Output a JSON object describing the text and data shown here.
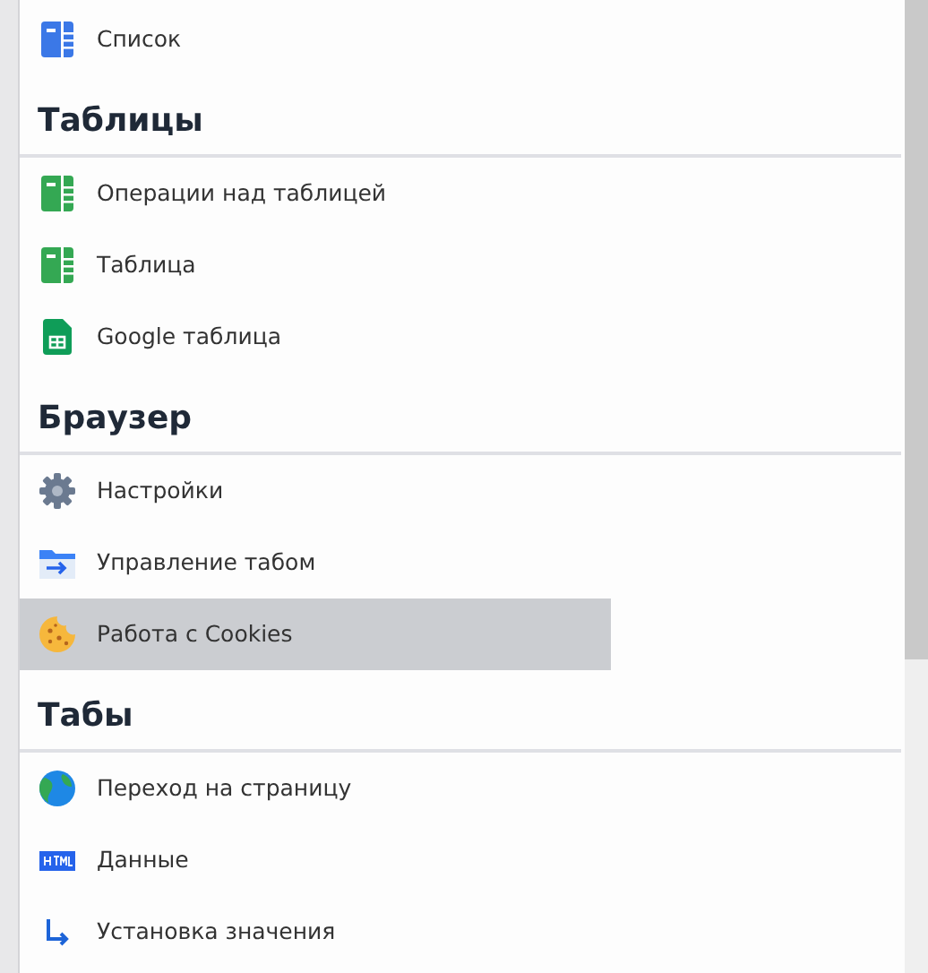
{
  "sections": [
    {
      "items": [
        {
          "label": "Список",
          "kind": "list",
          "selected": false
        }
      ]
    },
    {
      "title": "Таблицы",
      "items": [
        {
          "label": "Операции над таблицей",
          "kind": "sheet",
          "selected": false
        },
        {
          "label": "Таблица",
          "kind": "sheet",
          "selected": false
        },
        {
          "label": "Google таблица",
          "kind": "gsheet",
          "selected": false
        }
      ]
    },
    {
      "title": "Браузер",
      "items": [
        {
          "label": "Настройки",
          "kind": "gear",
          "selected": false
        },
        {
          "label": "Управление табом",
          "kind": "tab",
          "selected": false
        },
        {
          "label": "Работа с Cookies",
          "kind": "cookie",
          "selected": true
        }
      ]
    },
    {
      "title": "Табы",
      "items": [
        {
          "label": "Переход на страницу",
          "kind": "globe",
          "selected": false
        },
        {
          "label": "Данные",
          "kind": "html",
          "selected": false
        },
        {
          "label": "Установка значения",
          "kind": "arrow",
          "selected": false
        }
      ]
    }
  ]
}
